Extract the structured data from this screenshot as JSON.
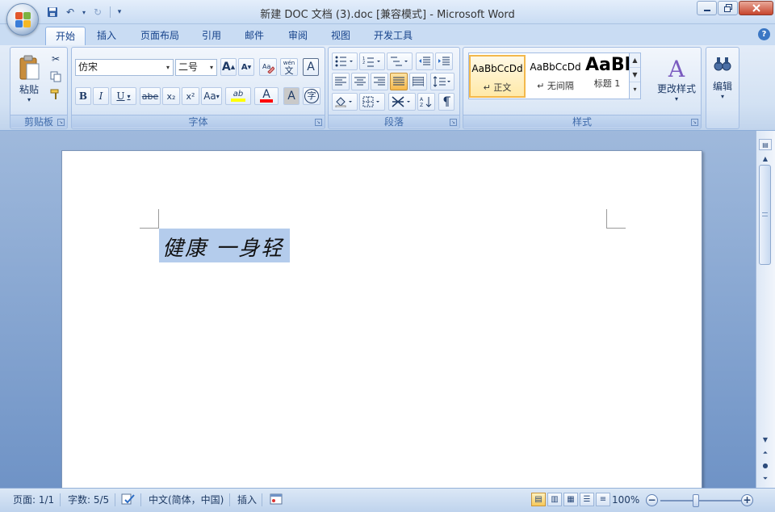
{
  "window": {
    "title": "新建 DOC 文档 (3).doc [兼容模式] - Microsoft Word",
    "minimize": "▭",
    "restore": "⧉",
    "close": "✕"
  },
  "tabs": [
    "开始",
    "插入",
    "页面布局",
    "引用",
    "邮件",
    "审阅",
    "视图",
    "开发工具"
  ],
  "active_tab": "开始",
  "ribbon": {
    "clipboard": {
      "label": "剪贴板",
      "paste": "粘贴"
    },
    "font": {
      "label": "字体",
      "font_name": "仿宋",
      "font_size": "二号",
      "bold": "B",
      "italic": "I",
      "underline": "U",
      "strike": "abe",
      "subscript": "x₂",
      "superscript": "x²",
      "change_case": "Aa",
      "grow": "A",
      "shrink": "A",
      "phonetic": "wén",
      "phonetic_char": "文",
      "border_a": "A",
      "highlight": "ab",
      "font_color": "A",
      "char_shade": "A",
      "enclose": "字"
    },
    "paragraph": {
      "label": "段落"
    },
    "styles": {
      "label": "样式",
      "items": [
        {
          "preview": "AaBbCcDd",
          "name": "↵ 正文"
        },
        {
          "preview": "AaBbCcDd",
          "name": "↵ 无间隔"
        },
        {
          "preview": "AaBb",
          "name": "标题 1"
        }
      ],
      "change_styles": "更改样式",
      "change_icon": "A"
    },
    "editing": {
      "label": "编辑"
    }
  },
  "document": {
    "text": "健康 一身轻"
  },
  "statusbar": {
    "page": "页面: 1/1",
    "words": "字数: 5/5",
    "language": "中文(简体，中国)",
    "mode": "插入",
    "zoom": "100%",
    "zoom_level": 100
  },
  "colors": {
    "accent": "#15428b",
    "highlight_yellow": "#ffff00",
    "font_red": "#ff0000",
    "selection": "#b4ccec"
  }
}
